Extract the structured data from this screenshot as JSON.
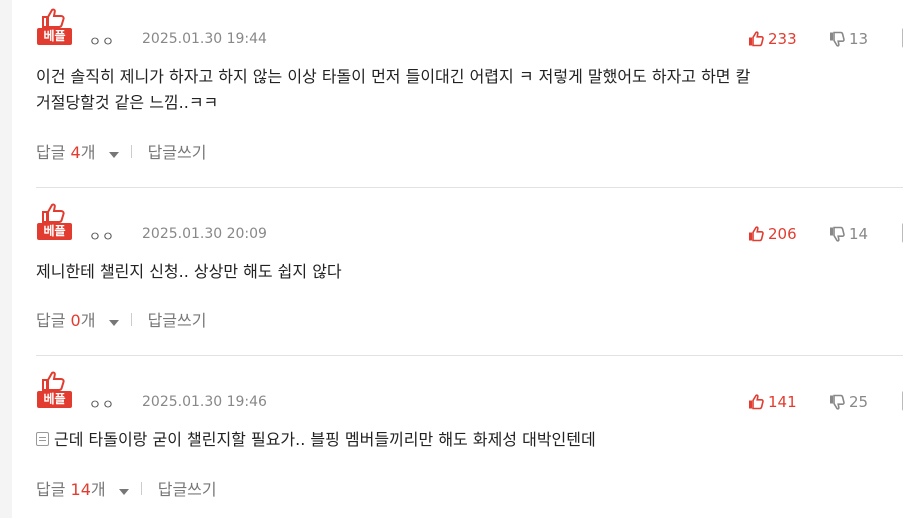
{
  "colors": {
    "accent": "#e23c30",
    "muted": "#888888",
    "divider": "#e2e2e2"
  },
  "comments": [
    {
      "badge": "베플",
      "nickname": "ㅇㅇ",
      "date": "2025.01.30 19:44",
      "likes": "233",
      "dislikes": "13",
      "text_lines": [
        "이건 솔직히 제니가 하자고 하지 않는 이상 타돌이 먼저 들이대긴 어렵지 ㅋ 저렇게 말했어도 하자고 하면 칼",
        "거절당할것 같은 느낌..ㅋㅋ"
      ],
      "reply_label": "답글",
      "reply_count": "4",
      "reply_unit": "개",
      "write_reply": "답글쓰기"
    },
    {
      "badge": "베플",
      "nickname": "ㅇㅇ",
      "date": "2025.01.30 20:09",
      "likes": "206",
      "dislikes": "14",
      "text_lines": [
        "제니한테 챌린지 신청.. 상상만 해도 쉽지 않다"
      ],
      "reply_label": "답글",
      "reply_count": "0",
      "reply_unit": "개",
      "write_reply": "답글쓰기"
    },
    {
      "badge": "베플",
      "nickname": "ㅇㅇ",
      "date": "2025.01.30 19:46",
      "likes": "141",
      "dislikes": "25",
      "has_memo_icon": true,
      "text_lines": [
        "근데 타돌이랑 굳이 챌린지할 필요가.. 블핑 멤버들끼리만 해도 화제성 대박인텐데"
      ],
      "reply_label": "답글",
      "reply_count": "14",
      "reply_unit": "개",
      "write_reply": "답글쓰기"
    }
  ]
}
